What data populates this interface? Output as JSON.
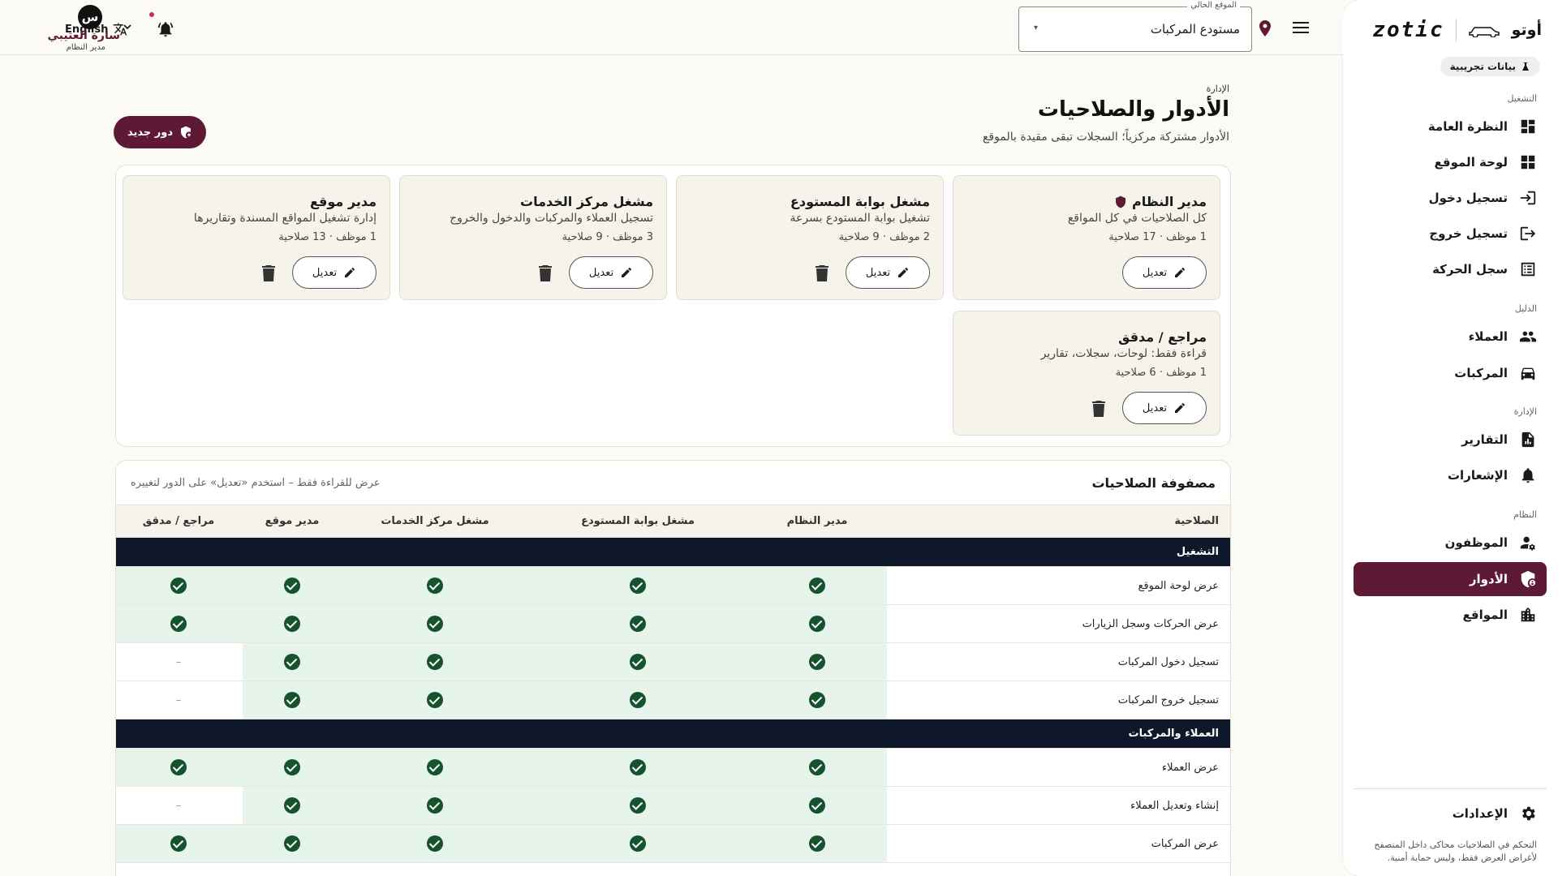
{
  "sidebar": {
    "brand_ar": "أوتو",
    "brand_en": "zotic",
    "demo_badge": "بيانات تجريبية",
    "groups": {
      "operations": "التشغيل",
      "directory": "الدليل",
      "management": "الإدارة",
      "system": "النظام"
    },
    "items": {
      "overview": "النظرة العامة",
      "site_dashboard": "لوحة الموقع",
      "checkin": "تسجيل دخول",
      "checkout": "تسجيل خروج",
      "movement_log": "سجل الحركة",
      "customers": "العملاء",
      "vehicles": "المركبات",
      "reports": "التقارير",
      "notifications": "الإشعارات",
      "employees": "الموظفون",
      "roles": "الأدوار",
      "sites": "المواقع"
    },
    "settings": "الإعدادات",
    "note": "التحكم في الصلاحيات محاكى داخل المتصفح لأغراض العرض فقط، وليس حماية أمنية."
  },
  "topbar": {
    "location_label": "الموقع الحالي",
    "location_value": "مستودع المركبات",
    "language": "English",
    "user_initial": "س",
    "user_name": "سارة العتيبي",
    "user_role": "مدير النظام"
  },
  "page": {
    "breadcrumb": "الإدارة",
    "title": "الأدوار والصلاحيات",
    "subtitle": "الأدوار مشتركة مركزياً؛ السجلات تبقى مقيدة بالموقع",
    "new_role": "دور جديد"
  },
  "roles": [
    {
      "name": "مدير النظام",
      "desc": "كل الصلاحيات في كل المواقع",
      "meta": "1 موظف · 17 صلاحية",
      "edit": "تعديل",
      "protected": true
    },
    {
      "name": "مشغل بوابة المستودع",
      "desc": "تشغيل بوابة المستودع بسرعة",
      "meta": "2 موظف · 9 صلاحية",
      "edit": "تعديل"
    },
    {
      "name": "مشغل مركز الخدمات",
      "desc": "تسجيل العملاء والمركبات والدخول والخروج",
      "meta": "3 موظف · 9 صلاحية",
      "edit": "تعديل"
    },
    {
      "name": "مدير موقع",
      "desc": "إدارة تشغيل المواقع المسندة وتقاريرها",
      "meta": "1 موظف · 13 صلاحية",
      "edit": "تعديل"
    },
    {
      "name": "مراجع / مدقق",
      "desc": "قراءة فقط: لوحات، سجلات، تقارير",
      "meta": "1 موظف · 6 صلاحية",
      "edit": "تعديل"
    }
  ],
  "matrix": {
    "title": "مصفوفة الصلاحيات",
    "hint": "عرض للقراءة فقط – استخدم «تعديل» على الدور لتغييره",
    "headers": [
      "الصلاحية",
      "مدير النظام",
      "مشغل بوابة المستودع",
      "مشغل مركز الخدمات",
      "مدير موقع",
      "مراجع / مدقق"
    ],
    "sections": [
      {
        "name": "التشغيل",
        "rows": [
          {
            "perm": "عرض لوحة الموقع",
            "cells": [
              1,
              1,
              1,
              1,
              1
            ]
          },
          {
            "perm": "عرض الحركات وسجل الزيارات",
            "cells": [
              1,
              1,
              1,
              1,
              1
            ]
          },
          {
            "perm": "تسجيل دخول المركبات",
            "cells": [
              1,
              1,
              1,
              1,
              0
            ]
          },
          {
            "perm": "تسجيل خروج المركبات",
            "cells": [
              1,
              1,
              1,
              1,
              0
            ]
          }
        ]
      },
      {
        "name": "العملاء والمركبات",
        "rows": [
          {
            "perm": "عرض العملاء",
            "cells": [
              1,
              1,
              1,
              1,
              1
            ]
          },
          {
            "perm": "إنشاء وتعديل العملاء",
            "cells": [
              1,
              1,
              1,
              1,
              0
            ]
          },
          {
            "perm": "عرض المركبات",
            "cells": [
              1,
              1,
              1,
              1,
              1
            ]
          }
        ]
      }
    ],
    "no_mark": "–"
  },
  "colors": {
    "accent": "#5e1a34",
    "check": "#14532d",
    "section_bg": "#0f172a",
    "allowed_bg": "#e7f4ec"
  }
}
